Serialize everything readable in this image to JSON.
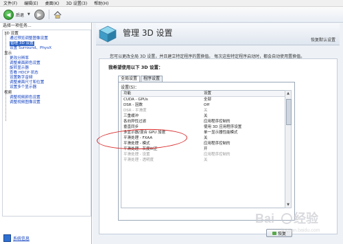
{
  "menu": [
    "文件(F)",
    "编辑(E)",
    "桌面(K)",
    "3D 设置(3)",
    "帮助(H)"
  ],
  "toolbar": {
    "back_label": "后退"
  },
  "left": {
    "task_header": "选择一项任务...",
    "tree": [
      {
        "label": "3D 设置",
        "level": 0,
        "link": false
      },
      {
        "label": "通过预览调整图像设置",
        "level": 1,
        "link": true
      },
      {
        "label": "管理 3D 设置",
        "level": 1,
        "link": true,
        "selected": true
      },
      {
        "label": "设置 Surround、PhysX",
        "level": 1,
        "link": true
      },
      {
        "label": "显示",
        "level": 0,
        "link": false
      },
      {
        "label": "更改分辨率",
        "level": 1,
        "link": true
      },
      {
        "label": "调整桌面颜色设置",
        "level": 1,
        "link": true
      },
      {
        "label": "旋转显示器",
        "level": 1,
        "link": true
      },
      {
        "label": "查看 HDCP 状态",
        "level": 1,
        "link": true
      },
      {
        "label": "设置数字音频",
        "level": 1,
        "link": true
      },
      {
        "label": "调整桌面尺寸和位置",
        "level": 1,
        "link": true
      },
      {
        "label": "设置多个显示器",
        "level": 1,
        "link": true
      },
      {
        "label": "视频",
        "level": 0,
        "link": false
      },
      {
        "label": "调整视频颜色设置",
        "level": 1,
        "link": true
      },
      {
        "label": "调整视频图像设置",
        "level": 1,
        "link": true
      }
    ],
    "system_info": "系统信息"
  },
  "right": {
    "title": "管理 3D 设置",
    "restore_defaults": "恢复默认设置",
    "description": "您可以更改全局 3D 设置，并且建立特定程序的置换值。 每次这些特定程序启动时，都会自动使用置换值。",
    "prompt": "我希望使用以下 3D 设置：",
    "tabs": [
      "全局设置",
      "程序设置"
    ],
    "settings_label": "设置(S)：",
    "columns": {
      "feature": "功能",
      "setting": "设置"
    },
    "rows": [
      {
        "feature": "CUDA - GPUs",
        "setting": "全部",
        "dim": false
      },
      {
        "feature": "DSR - 因数",
        "setting": "Off",
        "dim": false
      },
      {
        "feature": "DSR - 平滑度",
        "setting": "关",
        "dim": true
      },
      {
        "feature": "三重缓冲",
        "setting": "关",
        "dim": false
      },
      {
        "feature": "各向异性过滤",
        "setting": "应用程序控制的",
        "dim": false
      },
      {
        "feature": "垂直同步",
        "setting": "使用 3D 应用程序设置",
        "dim": false
      },
      {
        "feature": "多显示器/混合 GPU 加速",
        "setting": "单一显示器性能模式",
        "dim": false
      },
      {
        "feature": "平滑处理 - FXAA",
        "setting": "关",
        "dim": false
      },
      {
        "feature": "平滑处理 - 模式",
        "setting": "应用程序控制的",
        "dim": false
      },
      {
        "feature": "平滑处理 - 灰度纠正",
        "setting": "开",
        "dim": false
      },
      {
        "feature": "平滑处理 - 设置",
        "setting": "应用程序控制的",
        "dim": true
      },
      {
        "feature": "平滑处理 - 透明度",
        "setting": "关",
        "dim": true
      }
    ],
    "restore_button": "恢复"
  }
}
